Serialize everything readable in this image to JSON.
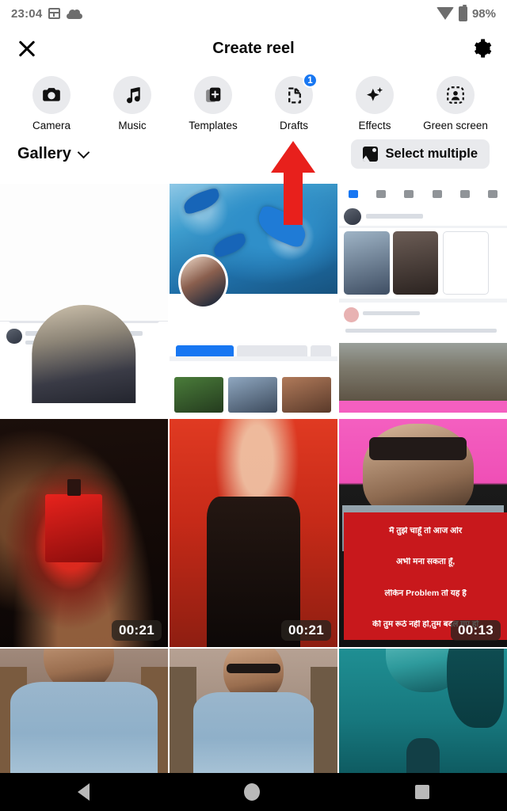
{
  "status_bar": {
    "time": "23:04",
    "battery_percent": "98%",
    "icons": [
      "calendar-icon",
      "cloud-icon",
      "wifi-icon",
      "battery-icon"
    ]
  },
  "header": {
    "title": "Create reel",
    "close_icon": "close-icon",
    "settings_icon": "gear-icon"
  },
  "toolbar": {
    "items": [
      {
        "label": "Camera",
        "icon": "camera-icon",
        "badge": ""
      },
      {
        "label": "Music",
        "icon": "music-note-icon",
        "badge": ""
      },
      {
        "label": "Templates",
        "icon": "templates-icon",
        "badge": ""
      },
      {
        "label": "Drafts",
        "icon": "drafts-icon",
        "badge": "1"
      },
      {
        "label": "Effects",
        "icon": "sparkle-icon",
        "badge": ""
      },
      {
        "label": "Green screen",
        "icon": "green-screen-icon",
        "badge": ""
      }
    ]
  },
  "gallery_bar": {
    "title": "Gallery",
    "chevron_icon": "chevron-down-icon",
    "select_multiple_label": "Select multiple",
    "select_multiple_icon": "image-icon"
  },
  "annotation": {
    "type": "arrow",
    "color": "#e8201c",
    "points_to": "Drafts"
  },
  "gallery": {
    "columns": 3,
    "items": [
      {
        "name": "screenshot-social-feed",
        "kind": "image",
        "duration": ""
      },
      {
        "name": "screenshot-profile-page",
        "kind": "image",
        "duration": ""
      },
      {
        "name": "screenshot-app-home",
        "kind": "image",
        "duration": ""
      },
      {
        "name": "video-perfume-ad",
        "kind": "video",
        "duration": "00:21"
      },
      {
        "name": "video-red-background",
        "kind": "video",
        "duration": "00:21"
      },
      {
        "name": "video-hindi-quote",
        "kind": "video",
        "duration": "00:13"
      },
      {
        "name": "video-man-blue-shirt",
        "kind": "video",
        "duration": ""
      },
      {
        "name": "video-man-sunglasses",
        "kind": "video",
        "duration": ""
      },
      {
        "name": "video-teal-portrait",
        "kind": "video",
        "duration": ""
      }
    ],
    "hindi_overlay_lines": [
      "मै तुझे चाहूँ तो आज ओर",
      "अभी मना सकता हूँ,",
      "लेकिन Problem तो यह है",
      "की तुम रूठे नहीं हो,तुम बदल गए हो"
    ]
  },
  "nav_bar": {
    "back_icon": "back-triangle-icon",
    "home_icon": "home-circle-icon",
    "recents_icon": "recents-square-icon"
  },
  "colors": {
    "accent_blue": "#1877f2",
    "chip_grey": "#e9eaed",
    "annotation_red": "#e8201c"
  }
}
